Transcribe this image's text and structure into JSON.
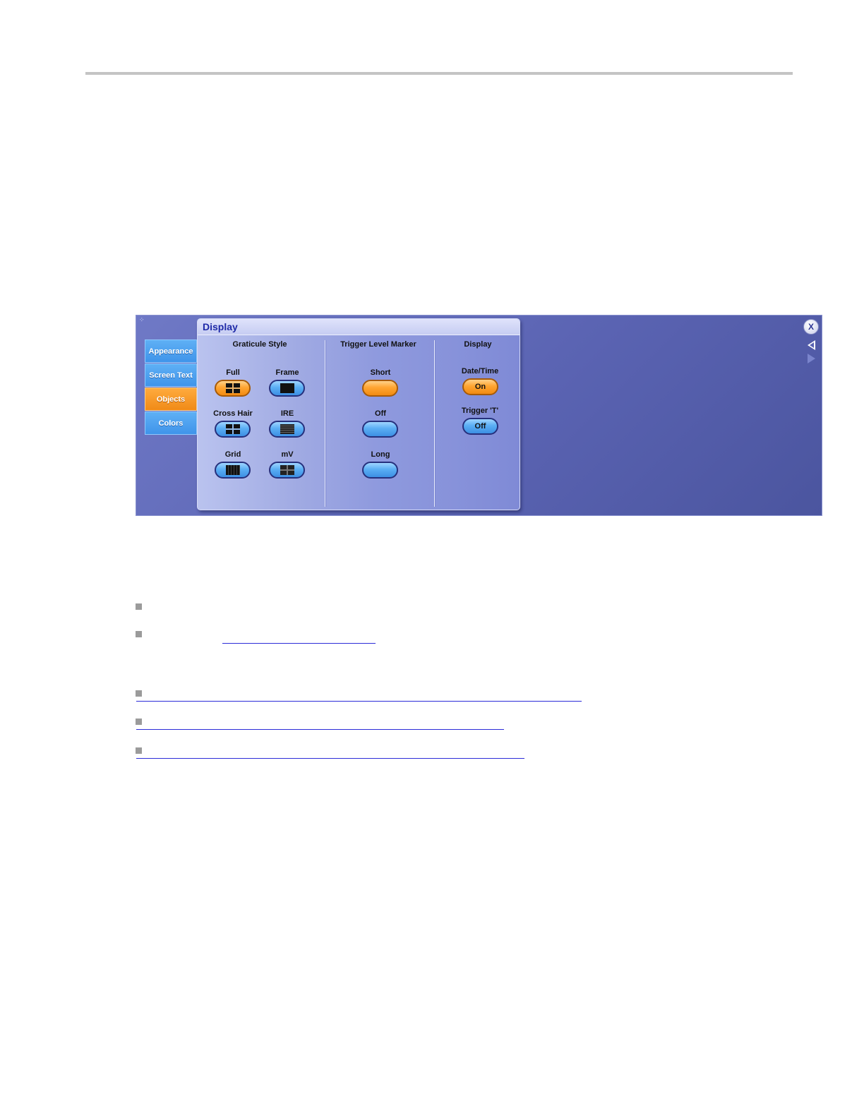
{
  "panel": {
    "title": "Display",
    "close_label": "X",
    "tabs": [
      {
        "label": "Appearance",
        "active": false
      },
      {
        "label": "Screen Text",
        "active": false
      },
      {
        "label": "Objects",
        "active": true
      },
      {
        "label": "Colors",
        "active": false
      }
    ],
    "graticule": {
      "title": "Graticule Style",
      "options": {
        "full": "Full",
        "frame": "Frame",
        "cross_hair": "Cross Hair",
        "ire": "IRE",
        "grid": "Grid",
        "mv": "mV"
      },
      "selected": "Full"
    },
    "trigger_marker": {
      "title": "Trigger Level Marker",
      "options": {
        "short": "Short",
        "off": "Off",
        "long": "Long"
      },
      "selected": "Short"
    },
    "display": {
      "title": "Display",
      "date_time_label": "Date/Time",
      "date_time_value": "On",
      "trigger_t_label": "Trigger 'T'",
      "trigger_t_value": "Off"
    }
  },
  "colors": {
    "active_orange": "#f5941e",
    "tab_blue": "#4a9ff0",
    "panel_bg": "#5a63b2"
  }
}
